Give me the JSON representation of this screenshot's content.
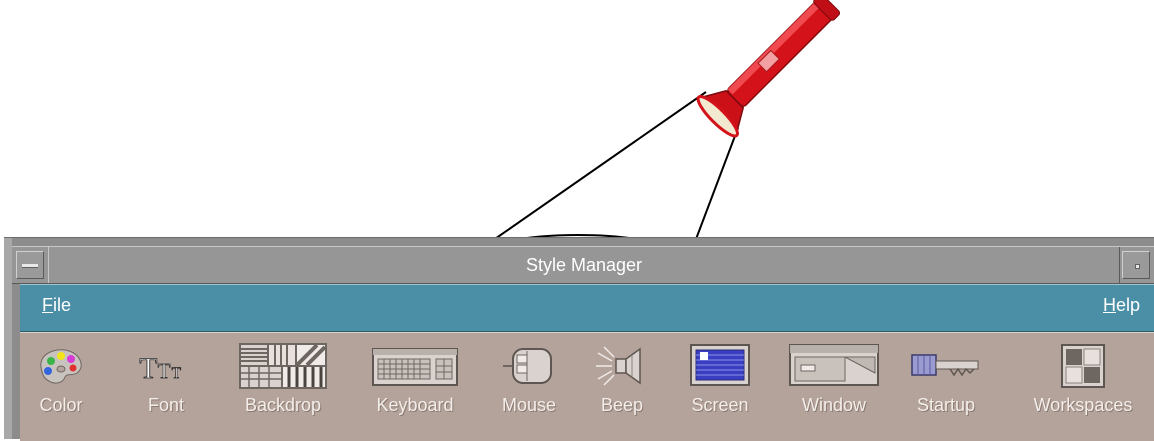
{
  "window": {
    "title": "Style Manager"
  },
  "menubar": {
    "file": {
      "mnemonic": "F",
      "rest": "ile"
    },
    "help": {
      "mnemonic": "H",
      "rest": "elp"
    }
  },
  "toolbar": {
    "items": [
      {
        "label": "Color",
        "icon": "palette-icon"
      },
      {
        "label": "Font",
        "icon": "font-icon"
      },
      {
        "label": "Backdrop",
        "icon": "backdrop-icon"
      },
      {
        "label": "Keyboard",
        "icon": "keyboard-icon"
      },
      {
        "label": "Mouse",
        "icon": "mouse-icon"
      },
      {
        "label": "Beep",
        "icon": "speaker-icon"
      },
      {
        "label": "Screen",
        "icon": "screen-icon"
      },
      {
        "label": "Window",
        "icon": "window-icon"
      },
      {
        "label": "Startup",
        "icon": "key-icon"
      },
      {
        "label": "Workspaces",
        "icon": "workspaces-icon"
      }
    ]
  },
  "colors": {
    "menubar": "#4a8fa6",
    "toolbar": "#b4a39b",
    "titlebar": "#969696",
    "flashlight": "#d4121a"
  }
}
